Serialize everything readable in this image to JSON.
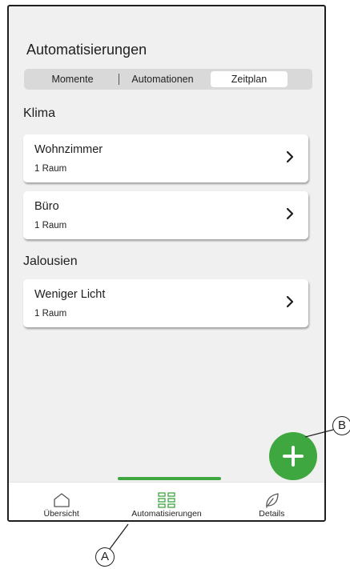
{
  "screen": {
    "title": "Automatisierungen",
    "tabs": [
      {
        "label": "Momente"
      },
      {
        "label": "Automationen"
      },
      {
        "label": "Zeitplan",
        "selected": true
      }
    ]
  },
  "sections": [
    {
      "title": "Klima",
      "items": [
        {
          "name": "Wohnzimmer",
          "sub": "1 Raum"
        },
        {
          "name": "Büro",
          "sub": "1 Raum"
        }
      ]
    },
    {
      "title": "Jalousien",
      "items": [
        {
          "name": "Weniger Licht",
          "sub": "1 Raum"
        }
      ]
    }
  ],
  "fab": {
    "icon": "plus-icon",
    "color": "#3ea740"
  },
  "bottom_nav": [
    {
      "label": "Übersicht",
      "icon": "home-icon"
    },
    {
      "label": "Automatisierungen",
      "icon": "grid-icon",
      "active": true
    },
    {
      "label": "Details",
      "icon": "leaf-icon"
    }
  ],
  "callouts": {
    "a": "A",
    "b": "B"
  },
  "colors": {
    "accent": "#3ea740",
    "background": "#f0f0f0",
    "card": "#ffffff"
  }
}
